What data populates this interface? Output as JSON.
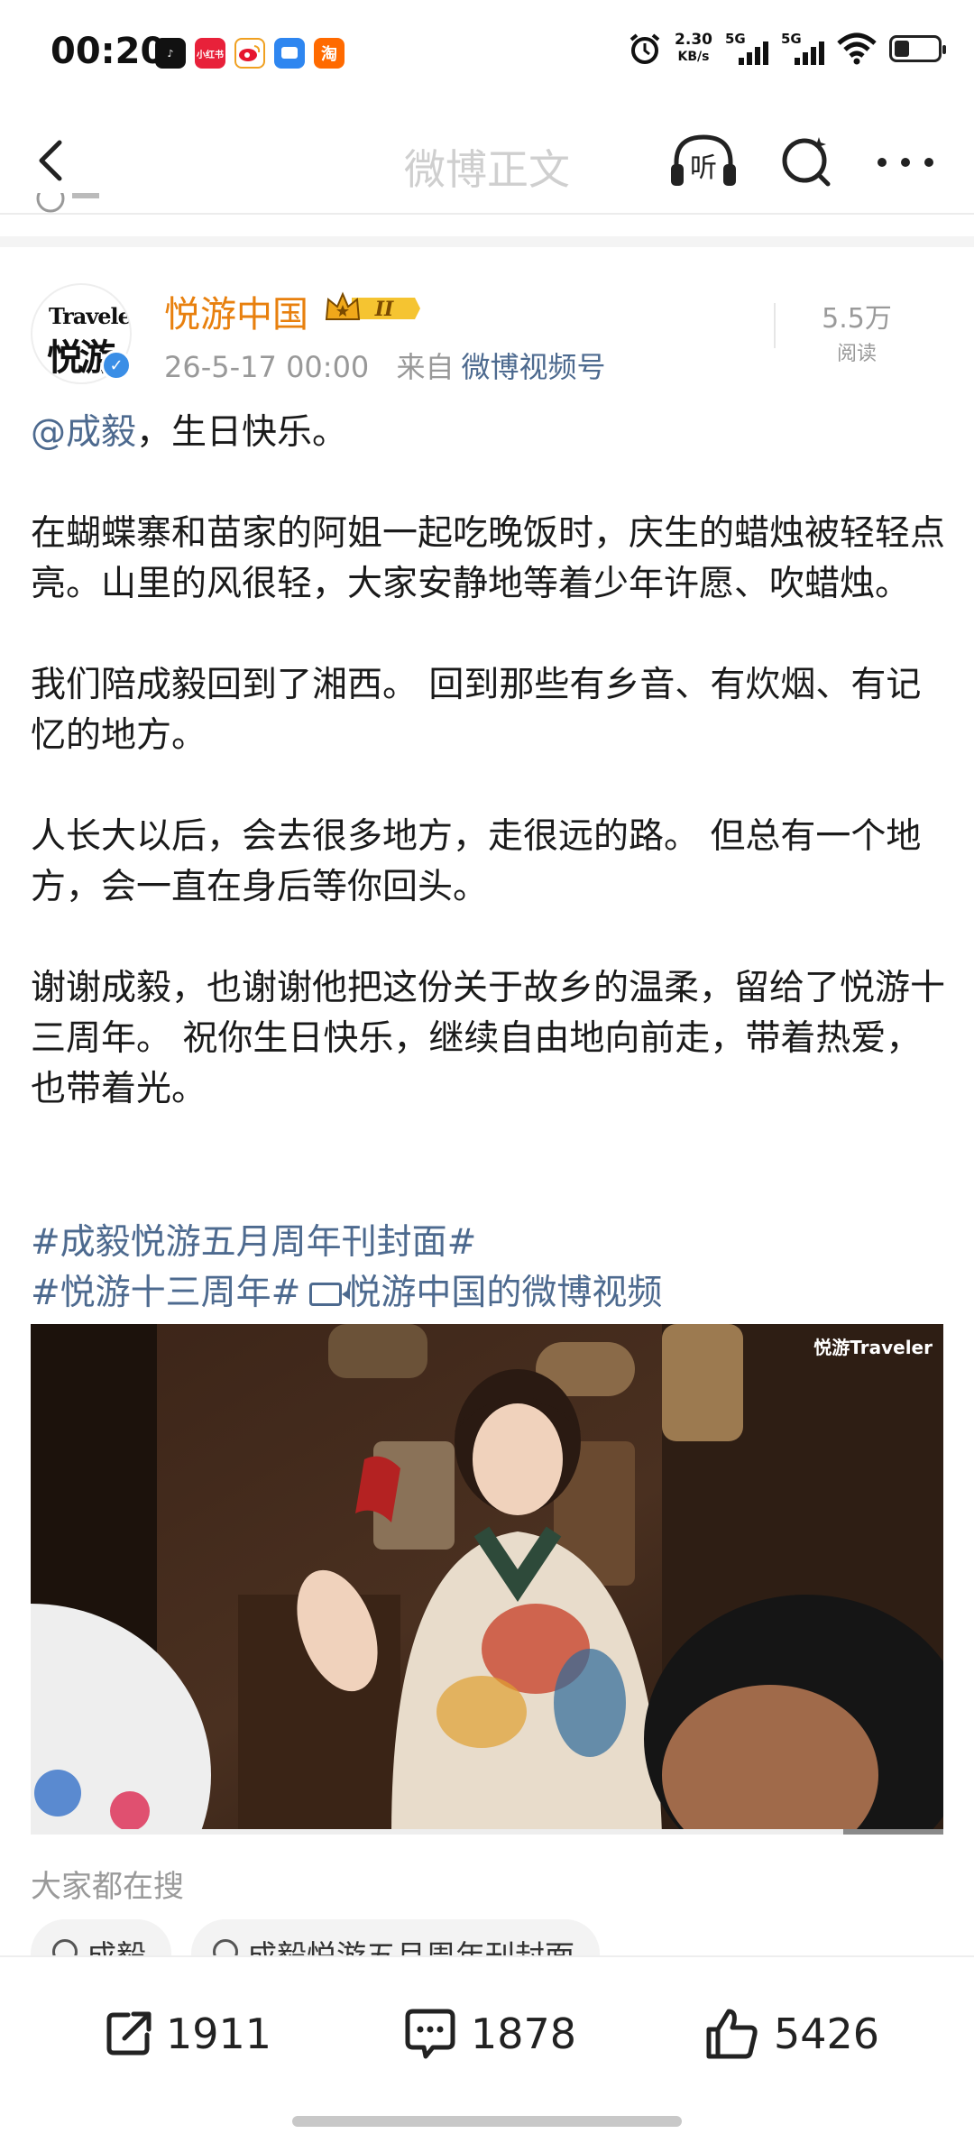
{
  "status_bar": {
    "time": "00:20",
    "net_speed_value": "2.30",
    "net_speed_unit": "KB/s",
    "signal_1": "5G",
    "signal_2": "5G",
    "apps": [
      "tiktok-icon",
      "xiaohongshu-icon",
      "weibo-icon",
      "message-icon",
      "taobao-icon"
    ],
    "app_labels": {
      "xiaohongshu": "小红书",
      "taobao": "淘"
    },
    "battery_level": 0.3
  },
  "nav": {
    "title": "微博正文",
    "listen_label": "听"
  },
  "post": {
    "author": {
      "name": "悦游中国",
      "avatar_text_1": "Traveler",
      "avatar_text_2": "悦游",
      "member_level": "II",
      "verified_mark": "✓"
    },
    "time": "26-5-17 00:00",
    "source_prefix": "来自",
    "source": "微博视频号",
    "reads_count": "5.5万",
    "reads_label": "阅读",
    "mention": "@成毅",
    "mention_suffix": "，生日快乐。",
    "paragraphs": [
      "在蝴蝶寨和苗家的阿姐一起吃晚饭时，庆生的蜡烛被轻轻点亮。山里的风很轻，大家安静地等着少年许愿、吹蜡烛。",
      "我们陪成毅回到了湘西。 回到那些有乡音、有炊烟、有记忆的地方。",
      "人长大以后，会去很多地方，走很远的路。 但总有一个地方，会一直在身后等你回头。",
      "谢谢成毅，也谢谢他把这份关于故乡的温柔，留给了悦游十三周年。 祝你生日快乐，继续自由地向前走，带着热爱，也带着光。"
    ],
    "tag_1": "#成毅悦游五月周年刊封面#",
    "tag_2": "#悦游十三周年#",
    "video_link": "悦游中国的微博视频",
    "video_watermark": "悦游Traveler",
    "video_progress": 0.89
  },
  "search": {
    "title": "大家都在搜",
    "chips": [
      "成毅",
      "成毅悦游五月周年刊封面"
    ]
  },
  "actions": {
    "repost_count": "1911",
    "comment_count": "1878",
    "like_count": "5426"
  },
  "colors": {
    "author_orange": "#e8800e",
    "link_blue": "#4d6a8f",
    "verified_blue": "#3a8ee6"
  }
}
